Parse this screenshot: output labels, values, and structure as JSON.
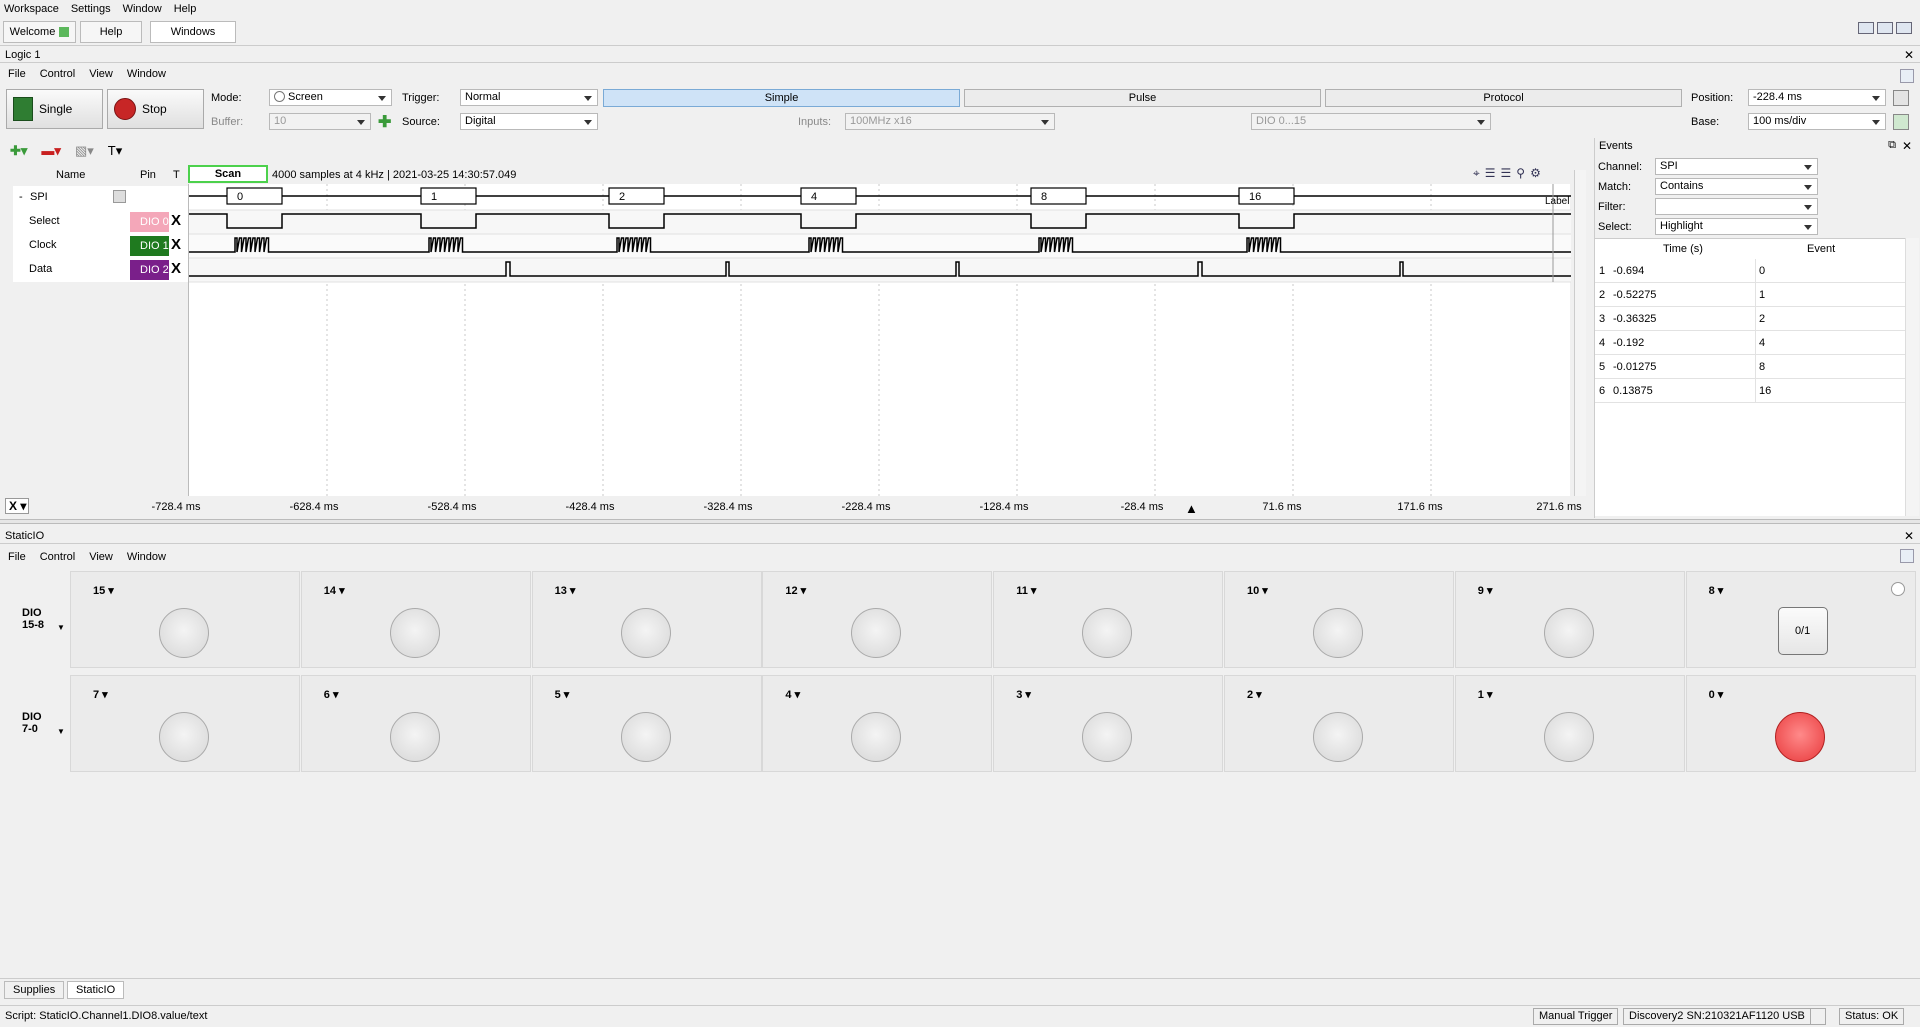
{
  "menubar": {
    "items": [
      "Workspace",
      "Settings",
      "Window",
      "Help"
    ]
  },
  "doc_tabs": [
    "Welcome",
    "Help",
    "Windows"
  ],
  "logic": {
    "title": "Logic 1",
    "menu": [
      "File",
      "Control",
      "View",
      "Window"
    ],
    "single_label": "Single",
    "stop_label": "Stop",
    "mode_label": "Mode:",
    "mode_value": "Screen",
    "buffer_label": "Buffer:",
    "buffer_value": "10",
    "trigger_label": "Trigger:",
    "trigger_value": "Normal",
    "source_label": "Source:",
    "source_value": "Digital",
    "trig_tabs": [
      "Simple",
      "Pulse",
      "Protocol"
    ],
    "inputs_label": "Inputs:",
    "inputs_value": "100MHz x16",
    "dio_range": "DIO 0...15",
    "position_label": "Position:",
    "position_value": "-228.4 ms",
    "base_label": "Base:",
    "base_value": "100 ms/div",
    "col_name": "Name",
    "col_pin": "Pin",
    "col_t": "T",
    "scan_label": "Scan",
    "info": "4000 samples at 4 kHz | 2021-03-25 14:30:57.049",
    "bus_name": "SPI",
    "bus_values": [
      "0",
      "1",
      "2",
      "4",
      "8",
      "16"
    ],
    "bus_label": "Label",
    "channels": [
      {
        "name": "Select",
        "pin": "DIO 0",
        "color": "#f4a7b9"
      },
      {
        "name": "Clock",
        "pin": "DIO 1",
        "color": "#1f7a1f"
      },
      {
        "name": "Data",
        "pin": "DIO 2",
        "color": "#7a1f8a"
      }
    ],
    "x_label": "X",
    "time_ticks": [
      "-728.4 ms",
      "-628.4 ms",
      "-528.4 ms",
      "-428.4 ms",
      "-328.4 ms",
      "-228.4 ms",
      "-128.4 ms",
      "-28.4 ms",
      "71.6 ms",
      "171.6 ms",
      "271.6 ms"
    ]
  },
  "events": {
    "title": "Events",
    "channel_label": "Channel:",
    "channel_value": "SPI",
    "match_label": "Match:",
    "match_value": "Contains",
    "filter_label": "Filter:",
    "filter_value": "",
    "select_label": "Select:",
    "select_value": "Highlight",
    "col_time": "Time (s)",
    "col_event": "Event",
    "rows": [
      {
        "n": "1",
        "time": "-0.694",
        "event": "0"
      },
      {
        "n": "2",
        "time": "-0.52275",
        "event": "1"
      },
      {
        "n": "3",
        "time": "-0.36325",
        "event": "2"
      },
      {
        "n": "4",
        "time": "-0.192",
        "event": "4"
      },
      {
        "n": "5",
        "time": "-0.01275",
        "event": "8"
      },
      {
        "n": "6",
        "time": "0.13875",
        "event": "16"
      }
    ]
  },
  "staticio": {
    "title": "StaticIO",
    "menu": [
      "File",
      "Control",
      "View",
      "Window"
    ],
    "group_high": "DIO\n15-8",
    "group_low": "DIO\n7-0",
    "high_pins": [
      "15",
      "14",
      "13",
      "12",
      "11",
      "10",
      "9",
      "8"
    ],
    "low_pins": [
      "7",
      "6",
      "5",
      "4",
      "3",
      "2",
      "1",
      "0"
    ],
    "button_label": "0/1",
    "dio0_state": "on",
    "on_color": "#e8393b"
  },
  "bottom_tabs": [
    "Supplies",
    "StaticIO"
  ],
  "status": {
    "script": "Script: StaticIO.Channel1.DIO8.value/text",
    "manual_trigger": "Manual Trigger",
    "device": "Discovery2 SN:210321AF1120 USB",
    "state": "Status: OK"
  }
}
